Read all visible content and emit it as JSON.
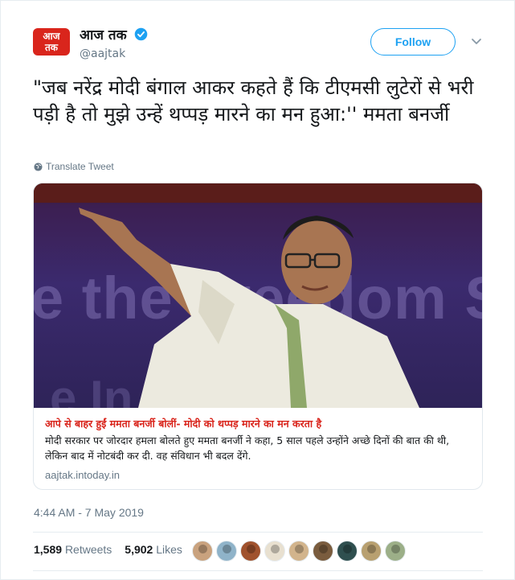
{
  "account": {
    "logo_line1": "आज",
    "logo_line2": "तक",
    "display_name": "आज तक",
    "handle": "@aajtak",
    "verified": true
  },
  "follow_label": "Follow",
  "tweet_text": "\"जब नरेंद्र मोदी बंगाल आकर कहते हैं कि टीएमसी लुटेरों से भरी पड़ी है तो मुझे उन्हें थप्पड़ मारने का मन हुआ:'' ममता बनर्जी",
  "translate_label": "Translate Tweet",
  "card": {
    "image_caption_partial": "e the  Freedom  Structu",
    "image_caption_partial2": "e  In              tra",
    "title": "आपे से बाहर हुईं ममता बनर्जी बोलीं- मोदी को थप्पड़ मारने का मन करता है",
    "description": "मोदी सरकार पर जोरदार हमला बोलते हुए ममता बनर्जी ने कहा, 5 साल पहले उन्होंने अच्छे दिनों की बात की थी, लेकिन बाद में नोटबंदी कर दी. वह संविधान भी बदल देंगे.",
    "domain": "aajtak.intoday.in"
  },
  "timestamp": "4:44 AM - 7 May 2019",
  "stats": {
    "retweets_count": "1,589",
    "retweets_label": "Retweets",
    "likes_count": "5,902",
    "likes_label": "Likes"
  },
  "colors": {
    "accent": "#1da1f2",
    "brand_red": "#d9251c",
    "muted": "#657786"
  },
  "liker_avatars": [
    "#c9a27e",
    "#8fb3c9",
    "#a0522d",
    "#e8e0d0",
    "#d2b48c",
    "#7a5c3e",
    "#2f4f4f",
    "#b8a070",
    "#9caf88"
  ]
}
